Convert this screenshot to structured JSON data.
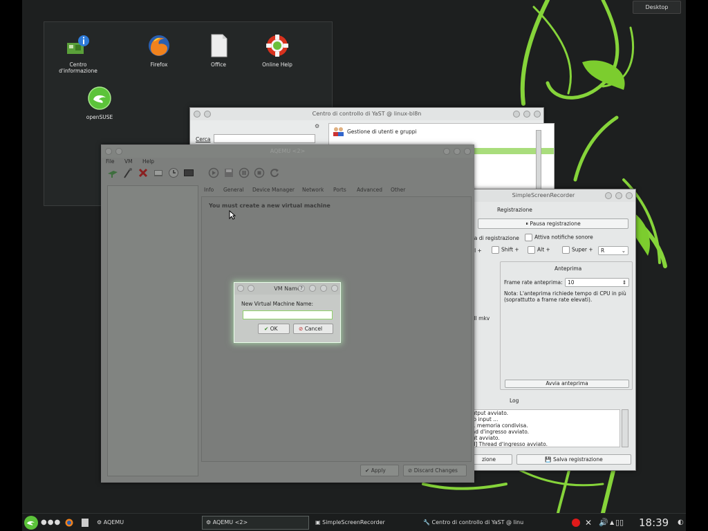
{
  "desktop": {
    "desktop_button": "Desktop",
    "icons": [
      {
        "label": "Centro d'informazione",
        "icon": "info-center-icon"
      },
      {
        "label": "Firefox",
        "icon": "firefox-icon"
      },
      {
        "label": "Office",
        "icon": "office-document-icon"
      },
      {
        "label": "Online Help",
        "icon": "lifebuoy-help-icon"
      },
      {
        "label": "openSUSE",
        "icon": "opensuse-icon"
      }
    ]
  },
  "yast": {
    "title": "Centro di controllo di YaST @ linux-bl8n",
    "search_label": "Cerca",
    "items": [
      "Gestione di utenti e gruppi"
    ]
  },
  "ssr": {
    "title": "SimpleScreenRecorder",
    "section_record": "Registrazione",
    "pause_button": "Pausa registrazione",
    "hotkey_label": "da di registrazione",
    "notify_label": "Attiva notifiche sonore",
    "ctrl": "rl +",
    "shift": "Shift +",
    "alt": "Alt +",
    "super": "Super +",
    "key_value": "R",
    "left_partial": "all mkv",
    "preview_title": "Anteprima",
    "frame_rate_label": "Frame rate anteprima:",
    "frame_rate_value": "10",
    "note": "Nota: L'anteprima richiede tempo di CPU in più (soprattutto a frame rate elevati).",
    "preview_button": "Avvia anteprima",
    "log_title": "Log",
    "log_lines": [
      "output avviato.",
      "vio input ...",
      "11 memoria condivisa.",
      "ead d'ingresso avviato.",
      "put avviato.",
      "ad] Thread d'ingresso avviato."
    ],
    "cancel_partial": "zione",
    "save_button": "Salva registrazione"
  },
  "aqemu": {
    "title": "AQEMU <2>",
    "menu": [
      "File",
      "VM",
      "Help"
    ],
    "tabs": [
      "Info",
      "General",
      "Device Manager",
      "Network",
      "Ports",
      "Advanced",
      "Other"
    ],
    "message": "You must create a new virtual machine",
    "apply_button": "Apply",
    "discard_button": "Discard Changes"
  },
  "dialog": {
    "title": "VM Name",
    "label": "New Virtual Machine Name:",
    "value": "",
    "ok_button": "OK",
    "cancel_button": "Cancel"
  },
  "taskbar": {
    "tasks": [
      "AQEMU",
      "AQEMU <2>",
      "SimpleScreenRecorder",
      "Centro di controllo di YaST @ linu"
    ],
    "clock": "18:39"
  },
  "colors": {
    "accent_green": "#7ccd2e",
    "desktop_bg": "#1d1f1f"
  }
}
